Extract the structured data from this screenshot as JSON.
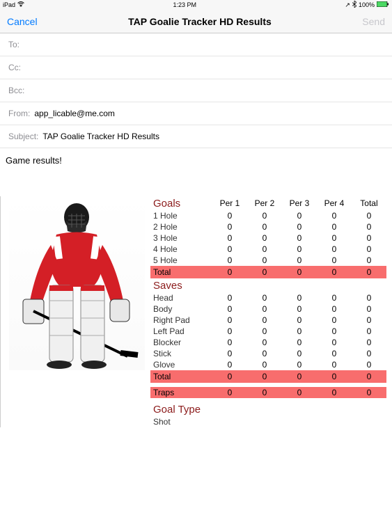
{
  "status": {
    "device": "iPad",
    "time": "1:23 PM",
    "battery": "100%"
  },
  "nav": {
    "cancel": "Cancel",
    "title": "TAP Goalie Tracker HD Results",
    "send": "Send"
  },
  "compose": {
    "to_label": "To:",
    "to_value": "",
    "cc_label": "Cc:",
    "cc_value": "",
    "bcc_label": "Bcc:",
    "bcc_value": "",
    "from_label": "From:",
    "from_value": "app_licable@me.com",
    "subject_label": "Subject:",
    "subject_value": "TAP Goalie Tracker HD Results"
  },
  "body": {
    "text": "Game results!"
  },
  "stats": {
    "columns": [
      "Per 1",
      "Per 2",
      "Per 3",
      "Per 4",
      "Total"
    ],
    "goals": {
      "title": "Goals",
      "rows": [
        {
          "label": "1 Hole",
          "v": [
            "0",
            "0",
            "0",
            "0",
            "0"
          ]
        },
        {
          "label": "2 Hole",
          "v": [
            "0",
            "0",
            "0",
            "0",
            "0"
          ]
        },
        {
          "label": "3 Hole",
          "v": [
            "0",
            "0",
            "0",
            "0",
            "0"
          ]
        },
        {
          "label": "4 Hole",
          "v": [
            "0",
            "0",
            "0",
            "0",
            "0"
          ]
        },
        {
          "label": "5 Hole",
          "v": [
            "0",
            "0",
            "0",
            "0",
            "0"
          ]
        }
      ],
      "total": {
        "label": "Total",
        "v": [
          "0",
          "0",
          "0",
          "0",
          "0"
        ]
      }
    },
    "saves": {
      "title": "Saves",
      "rows": [
        {
          "label": "Head",
          "v": [
            "0",
            "0",
            "0",
            "0",
            "0"
          ]
        },
        {
          "label": "Body",
          "v": [
            "0",
            "0",
            "0",
            "0",
            "0"
          ]
        },
        {
          "label": "Right Pad",
          "v": [
            "0",
            "0",
            "0",
            "0",
            "0"
          ]
        },
        {
          "label": "Left Pad",
          "v": [
            "0",
            "0",
            "0",
            "0",
            "0"
          ]
        },
        {
          "label": "Blocker",
          "v": [
            "0",
            "0",
            "0",
            "0",
            "0"
          ]
        },
        {
          "label": "Stick",
          "v": [
            "0",
            "0",
            "0",
            "0",
            "0"
          ]
        },
        {
          "label": "Glove",
          "v": [
            "0",
            "0",
            "0",
            "0",
            "0"
          ]
        }
      ],
      "total": {
        "label": "Total",
        "v": [
          "0",
          "0",
          "0",
          "0",
          "0"
        ]
      }
    },
    "traps": {
      "label": "Traps",
      "v": [
        "0",
        "0",
        "0",
        "0",
        "0"
      ]
    },
    "goal_type": {
      "title": "Goal Type",
      "rows": [
        {
          "label": "Shot",
          "v": [
            "",
            "",
            "",
            "",
            ""
          ]
        }
      ]
    }
  }
}
